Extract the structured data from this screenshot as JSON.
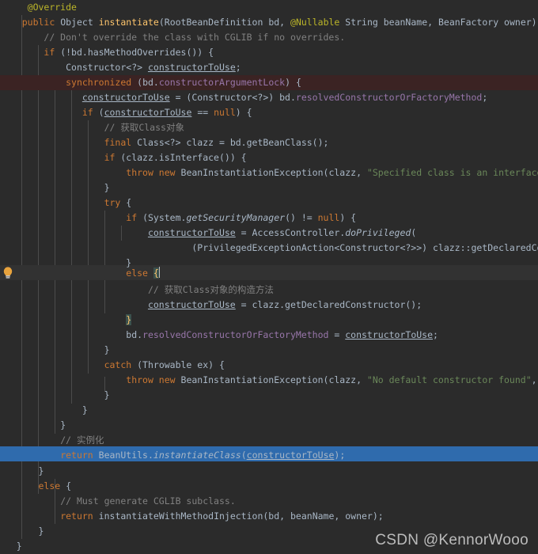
{
  "editor": {
    "theme": "darcula",
    "background": "#2b2b2b",
    "foreground": "#a9b7c6",
    "font_size_px": 11.5,
    "line_height_px": 19,
    "colors": {
      "keyword": "#cc7832",
      "annotation": "#bbb529",
      "comment": "#808080",
      "string": "#6a8759",
      "field": "#9876aa",
      "number": "#6897bb",
      "plain": "#a9b7c6",
      "brace_match_bg": "#3b514d",
      "brace_match_fg": "#ffc66d",
      "selection_bg": "#2f6bad",
      "error_band_bg": "#3b2323",
      "caret_row_bg": "#323232",
      "indent_guide": "#4b4b4b"
    },
    "gutter_icon": "lightbulb-icon",
    "selected_line_index": 29,
    "caret_line_index": 17,
    "error_line_index": 4
  },
  "code": {
    "language": "Java",
    "lines": [
      "@Override",
      "public Object instantiate(RootBeanDefinition bd, @Nullable String beanName, BeanFactory owner) {",
      "    // Don't override the class with CGLIB if no overrides.",
      "    if (!bd.hasMethodOverrides()) {",
      "        Constructor<?> constructorToUse;",
      "        synchronized (bd.constructorArgumentLock) {",
      "            constructorToUse = (Constructor<?>) bd.resolvedConstructorOrFactoryMethod;",
      "            if (constructorToUse == null) {",
      "                // 获取Class对象",
      "                final Class<?> clazz = bd.getBeanClass();",
      "                if (clazz.isInterface()) {",
      "                    throw new BeanInstantiationException(clazz, \"Specified class is an interface\");",
      "                }",
      "                try {",
      "                    if (System.getSecurityManager() != null) {",
      "                        constructorToUse = AccessController.doPrivileged(",
      "                                (PrivilegedExceptionAction<Constructor<?>>) clazz::getDeclaredConstructor);",
      "                    }",
      "                    else {",
      "                        // 获取Class对象的构造方法",
      "                        constructorToUse = clazz.getDeclaredConstructor();",
      "                    }",
      "                    bd.resolvedConstructorOrFactoryMethod = constructorToUse;",
      "                }",
      "                catch (Throwable ex) {",
      "                    throw new BeanInstantiationException(clazz, \"No default constructor found\", ex);",
      "                }",
      "            }",
      "        }",
      "        // 实例化",
      "        return BeanUtils.instantiateClass(constructorToUse);",
      "    }",
      "    else {",
      "        // Must generate CGLIB subclass.",
      "        return instantiateWithMethodInjection(bd, beanName, owner);",
      "    }",
      "}"
    ]
  },
  "watermark": {
    "text": "CSDN @KennorWooo"
  }
}
